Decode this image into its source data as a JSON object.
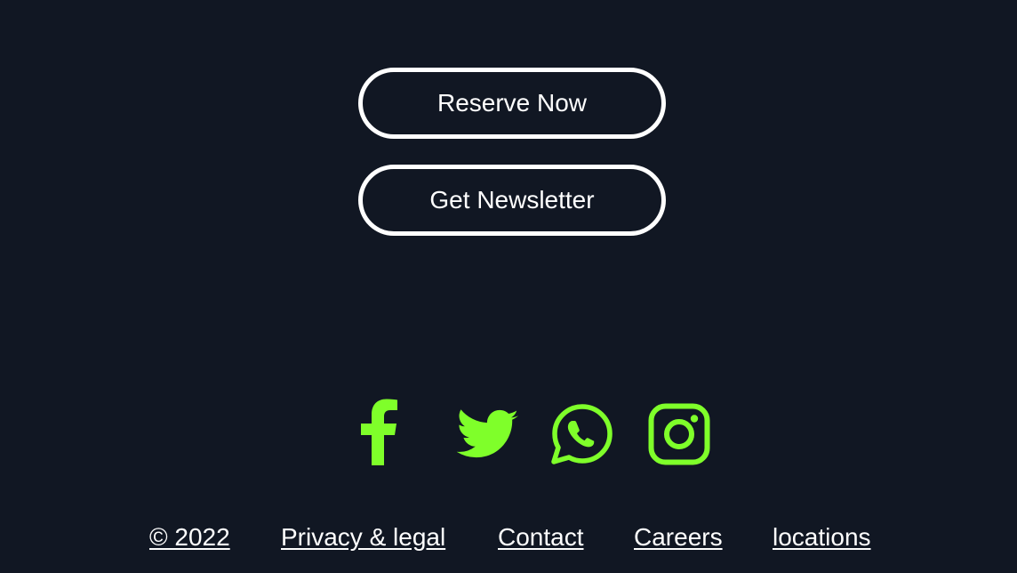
{
  "colors": {
    "background": "#111723",
    "text": "#ffffff",
    "accent": "#7fff2a"
  },
  "cta": {
    "reserve_label": "Reserve Now",
    "newsletter_label": "Get Newsletter"
  },
  "social": {
    "icons": [
      "facebook-icon",
      "twitter-icon",
      "whatsapp-icon",
      "instagram-icon"
    ]
  },
  "footer": {
    "links": [
      "© 2022",
      "Privacy & legal",
      "Contact",
      "Careers",
      "locations"
    ]
  }
}
